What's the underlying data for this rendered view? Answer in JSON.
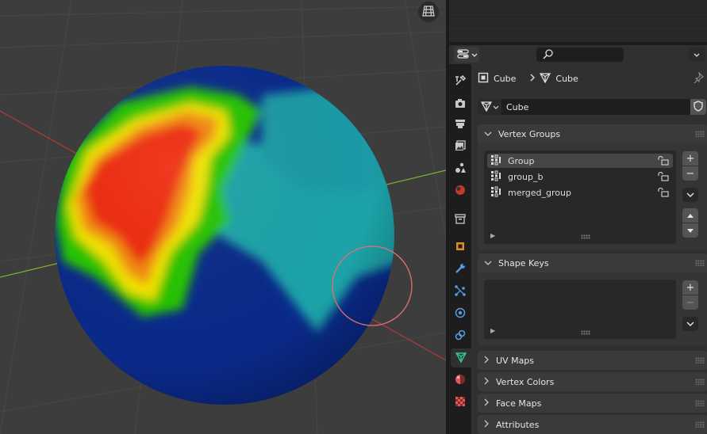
{
  "viewport": {
    "shading_icon": "grid-view-icon",
    "mesh_colors": {
      "weight_zero": "#0a2a8a",
      "weight_low": "#1fa3a8",
      "weight_mid": "#27c400",
      "weight_high": "#ee2a10",
      "axis_x": "#b33a3a",
      "axis_y": "#7fb232",
      "brush_circle": "#e07070"
    }
  },
  "header": {
    "editor_type_icon": "properties-editor-icon",
    "search_icon": "search-icon",
    "dropdown_icon": "chevron-down-icon"
  },
  "tabs": [
    {
      "name": "tool",
      "icon": "wrench-screwdriver-icon"
    },
    {
      "name": "render",
      "icon": "camera-icon"
    },
    {
      "name": "output",
      "icon": "printer-icon"
    },
    {
      "name": "view-layer",
      "icon": "image-stack-icon"
    },
    {
      "name": "scene",
      "icon": "scene-icon"
    },
    {
      "name": "world",
      "icon": "globe-icon"
    },
    {
      "name": "collection",
      "icon": "box-icon"
    },
    {
      "name": "object",
      "icon": "object-square-icon"
    },
    {
      "name": "modifiers",
      "icon": "wrench-icon"
    },
    {
      "name": "particles",
      "icon": "particles-icon"
    },
    {
      "name": "physics",
      "icon": "physics-orbit-icon"
    },
    {
      "name": "constraints",
      "icon": "constraint-icon"
    },
    {
      "name": "data",
      "icon": "mesh-data-icon"
    },
    {
      "name": "material",
      "icon": "material-sphere-icon"
    },
    {
      "name": "texture",
      "icon": "checker-icon"
    }
  ],
  "breadcrumb": {
    "object_name": "Cube",
    "mesh_name": "Cube"
  },
  "datablock": {
    "name": "Cube"
  },
  "vertex_groups": {
    "title": "Vertex Groups",
    "items": [
      {
        "name": "Group"
      },
      {
        "name": "group_b"
      },
      {
        "name": "merged_group"
      }
    ],
    "add_label": "+",
    "remove_label": "−"
  },
  "shape_keys": {
    "title": "Shape Keys",
    "add_label": "+",
    "remove_label": "−"
  },
  "collapsed_panels": [
    {
      "title": "UV Maps"
    },
    {
      "title": "Vertex Colors"
    },
    {
      "title": "Face Maps"
    },
    {
      "title": "Attributes"
    }
  ]
}
